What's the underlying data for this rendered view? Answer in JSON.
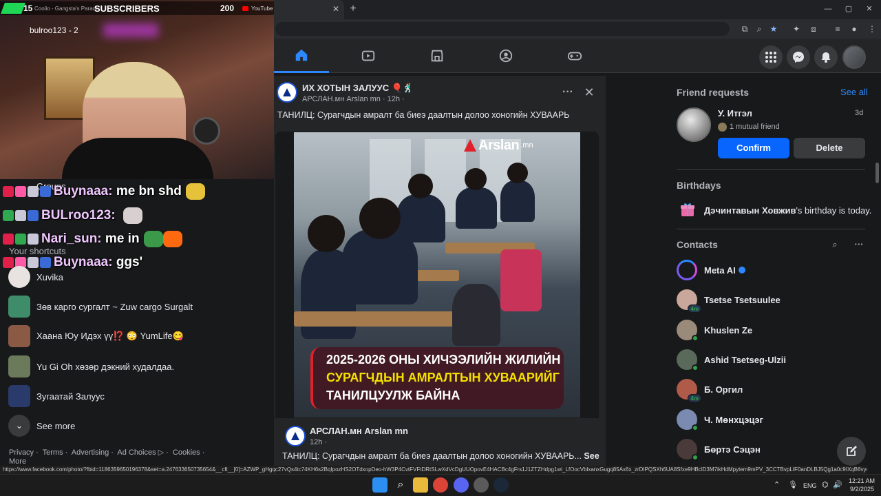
{
  "stream": {
    "sub_count": "15",
    "music": "Coolio - Gangsta's Paradi",
    "subs_label": "SUBSCRIBERS",
    "sub_username": "bulroo123 - 2",
    "views": "200",
    "platform": "YouTube",
    "chat": [
      {
        "user": "Buynaaa:",
        "msg": "me bn shd"
      },
      {
        "user": "BULroo123:",
        "msg": ""
      },
      {
        "user": "Nari_sun:",
        "msg": "me in"
      },
      {
        "user": "Buynaaa:",
        "msg": "ggs'"
      }
    ]
  },
  "left_sidebar": {
    "groups_label": "Groups",
    "your_shortcuts": "Your shortcuts",
    "shortcuts": [
      {
        "label": "Xuvika"
      },
      {
        "label": "Зөв карго сургалт ~ Zuw cargo Surgalt"
      },
      {
        "label": "Хаана Юу Идэх үү⁉️ 😳 YumLife😋"
      },
      {
        "label": "Yu Gi Oh хөзөр дэкний худалдаа."
      },
      {
        "label": "Зугаатай Залуус"
      }
    ],
    "see_more": "See more",
    "footer": [
      "Privacy ·",
      "Terms ·",
      "Advertising ·",
      "Ad Choices ▷ ·",
      "Cookies ·",
      "More"
    ]
  },
  "post": {
    "group": "ИХ ХОТЫН ЗАЛУУС 🎈🕺",
    "author_line": "АРСЛАН.мн Arslan mn · 12h ·",
    "caption": "ТАНИЛЦ: Сурагчдын амралт ба биеэ даалтын долоо хоногийн ХУВААРЬ",
    "logo_text": "Arslan",
    "logo_suffix": ".mn",
    "banner_lines": [
      "2025-2026 ОНЫ ХИЧЭЭЛИЙН ЖИЛИЙН",
      "СУРАГЧДЫН АМРАЛТЫН ХУВААРИЙГ",
      "ТАНИЛЦУУЛЖ БАЙНА"
    ],
    "footer_name": "АРСЛАН.мн Arslan mn",
    "footer_time": "12h ·",
    "footer_caption": "ТАНИЛЦ: Сурагчдын амралт ба биеэ даалтын долоо хоногийн ХУВААРЬ...",
    "see_more": "See"
  },
  "right_rail": {
    "friend_requests": "Friend requests",
    "see_all": "See all",
    "request": {
      "name": "У. Итгэл",
      "time": "3d",
      "mutual": "1 mutual friend"
    },
    "confirm": "Confirm",
    "delete": "Delete",
    "birthdays": "Birthdays",
    "birthday_name": "Дэчинтавын Ховжив",
    "birthday_suffix": "'s birthday is today.",
    "contacts": "Contacts",
    "contact_list": [
      {
        "name": "Meta AI",
        "badge": ""
      },
      {
        "name": "Tsetse Tsetsuulee",
        "badge": "4m"
      },
      {
        "name": "Khuslen Ze",
        "badge": ""
      },
      {
        "name": "Ashid Tsetseg-Ulzii",
        "badge": ""
      },
      {
        "name": "Б. Оргил",
        "badge": "4m"
      },
      {
        "name": "Ч. Мөнхцэцэг",
        "badge": ""
      },
      {
        "name": "Бөртэ Сэцэн",
        "badge": ""
      }
    ]
  },
  "status_url": "https://www.facebook.com/photo/?fbid=1186359650196378&set=a.247633650735654&__cft__[0]=AZWP_gHgqc27vQs4tc74KH6s2BqIpozHS2OTdxopDeo-hW3P4CvtFVFtDRtSLwXdVcDgUUOpovE4HACBc4gFrs1J1ZTZHdpg1wi_LfOocVblxanxGugq85Ax6x_zrDIPQSXh6UA8Sfxe9HBclD3M7ikHdMpytem9mPV_3CCTBvpLIF0anDLBJ5Qg1a0c9IXqB6vy4T0kCU-...",
  "taskbar": {
    "lang": "ENG",
    "time": "12:21 AM",
    "date": "9/2/2025"
  },
  "colors": {
    "accent": "#0866ff",
    "online": "#31a24c",
    "link": "#2d88ff"
  }
}
